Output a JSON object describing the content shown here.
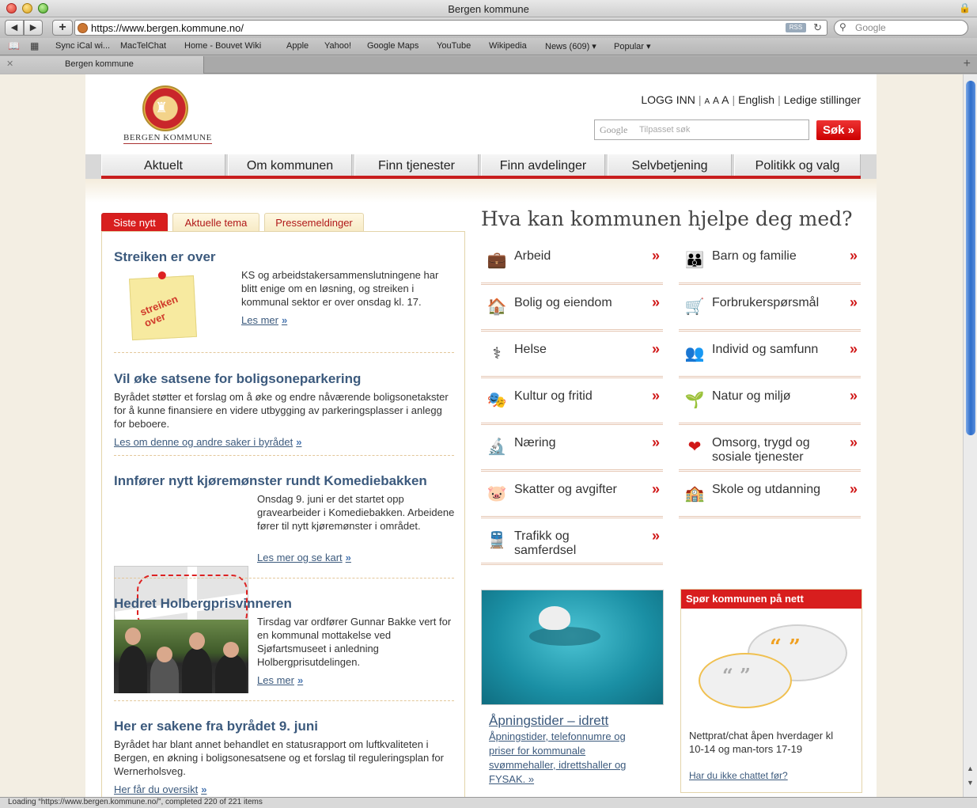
{
  "browser": {
    "window_title": "Bergen kommune",
    "url": "https://www.bergen.kommune.no/",
    "rss_label": "RSS",
    "search_placeholder": "Google",
    "tab_title": "Bergen kommune",
    "bookmarks": [
      "Sync iCal wi...",
      "MacTelChat",
      "Home - Bouvet Wiki",
      "Apple",
      "Yahoo!",
      "Google Maps",
      "YouTube",
      "Wikipedia",
      "News (609)",
      "Popular"
    ],
    "status": "Loading “https://www.bergen.kommune.no/”, completed 220 of 221 items"
  },
  "header": {
    "logo_text": "BERGEN KOMMUNE",
    "login": "LOGG INN",
    "font_small": "A",
    "font_mid": "A",
    "font_large": "A",
    "english": "English",
    "jobs": "Ledige stillinger",
    "search_logo": "Google",
    "search_placeholder": "Tilpasset søk",
    "search_button": "Søk »"
  },
  "menu": [
    "Aktuelt",
    "Om kommunen",
    "Finn tjenester",
    "Finn avdelinger",
    "Selvbetjening",
    "Politikk og valg"
  ],
  "news_tabs": [
    "Siste nytt",
    "Aktuelle tema",
    "Pressemeldinger"
  ],
  "news": [
    {
      "title": "Streiken er over",
      "text": "KS og arbeidstakersammenslutningene har blitt enige om en løsning, og streiken i kommunal sektor er over onsdag kl. 17.",
      "more": "Les mer",
      "note": "streiken over"
    },
    {
      "title": "Vil øke satsene for boligsoneparkering",
      "text": "Byrådet støtter et forslag om å øke og endre nåværende boligsonetakster for å kunne finansiere en videre utbygging av parkeringsplasser i anlegg for beboere.",
      "more": "Les om denne og andre saker i byrådet"
    },
    {
      "title": "Innfører nytt kjøremønster rundt Komediebakken",
      "text": "Onsdag 9. juni er det startet opp gravearbeider i Komediebakken. Arbeidene fører til nytt kjøremønster i området.",
      "more": "Les mer og se kart"
    },
    {
      "title": "Hedret Holbergprisvinneren",
      "text": "Tirsdag var ordfører Gunnar Bakke vert for en kommunal mottakelse ved Sjøfartsmuseet i anledning Holbergprisutdelingen.",
      "more": "Les mer"
    },
    {
      "title": "Her er sakene fra byrådet 9. juni",
      "text": "Byrådet har blant annet behandlet en statusrapport om luftkvaliteten i Bergen, en økning i boligsonesatsene og et forslag til reguleringsplan for Wernerholsveg.",
      "more": "Her får du oversikt"
    }
  ],
  "services_heading": "Hva kan kommunen hjelpe deg med?",
  "services": [
    {
      "label": "Arbeid",
      "icon": "💼"
    },
    {
      "label": "Barn og familie",
      "icon": "👪"
    },
    {
      "label": "Bolig og eiendom",
      "icon": "🏠"
    },
    {
      "label": "Forbrukerspørsmål",
      "icon": "🛒"
    },
    {
      "label": "Helse",
      "icon": "⚕"
    },
    {
      "label": "Individ og samfunn",
      "icon": "👥"
    },
    {
      "label": "Kultur og fritid",
      "icon": "🎭"
    },
    {
      "label": "Natur og miljø",
      "icon": "🌱"
    },
    {
      "label": "Næring",
      "icon": "🔬"
    },
    {
      "label": "Omsorg, trygd og sosiale tjenester",
      "icon": "❤"
    },
    {
      "label": "Skatter og avgifter",
      "icon": "🐷"
    },
    {
      "label": "Skole og utdanning",
      "icon": "🏫"
    },
    {
      "label": "Trafikk og samferdsel",
      "icon": "🚆"
    }
  ],
  "pool": {
    "title": "Åpningstider – idrett",
    "text": "Åpningstider, telefonnumre og priser for kommunale svømmehaller, idrettshaller og FYSAK. »"
  },
  "chat": {
    "heading": "Spør kommunen på nett",
    "text": "Nettprat/chat åpen hverdager kl 10-14 og man-tors 17-19",
    "link": "Har du ikke chattet før?"
  },
  "colors": {
    "brand_red": "#d81e1e",
    "link_blue": "#3c5a7d"
  }
}
